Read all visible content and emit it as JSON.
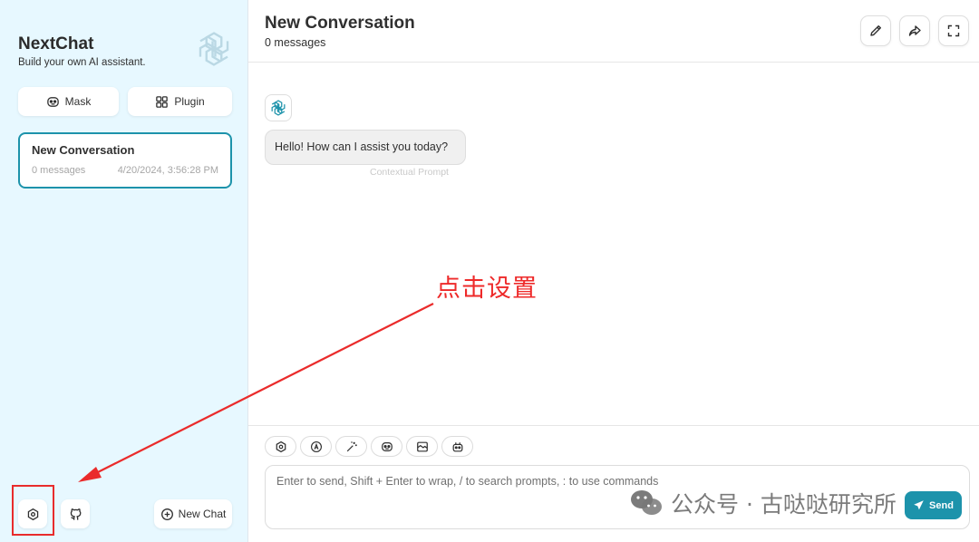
{
  "sidebar": {
    "app_name": "NextChat",
    "tagline": "Build your own AI assistant.",
    "mask_label": "Mask",
    "plugin_label": "Plugin",
    "conversation": {
      "title": "New Conversation",
      "count": "0 messages",
      "date": "4/20/2024, 3:56:28 PM"
    },
    "new_chat_label": "New Chat"
  },
  "header": {
    "title": "New Conversation",
    "subtitle": "0 messages"
  },
  "messages": [
    {
      "role": "assistant",
      "text": "Hello! How can I assist you today?",
      "note": "Contextual Prompt"
    }
  ],
  "input": {
    "placeholder": "Enter to send, Shift + Enter to wrap, / to search prompts, : to use commands",
    "send_label": "Send",
    "actions": [
      "settings-icon",
      "theme-auto-icon",
      "prompt-magic-icon",
      "mask-icon",
      "image-icon",
      "robot-icon"
    ]
  },
  "annotation": {
    "text": "点击设置",
    "color": "#ee2a2a"
  },
  "watermark": {
    "text": "公众号 · 古哒哒研究所"
  },
  "colors": {
    "accent": "#1d93ab",
    "sidebar_bg": "#e7f8ff"
  }
}
